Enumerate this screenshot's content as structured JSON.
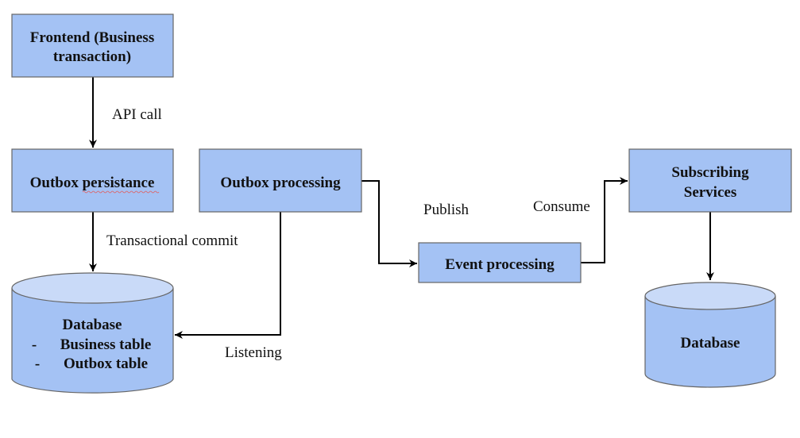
{
  "colors": {
    "box_fill": "#a4c2f4",
    "box_border": "#666666",
    "cylinder_top": "#c9daf8",
    "edge": "#000000"
  },
  "nodes": {
    "frontend": {
      "lines": [
        "Frontend (Business",
        "transaction)"
      ]
    },
    "outbox_persistance": {
      "lines": [
        "Outbox persistance"
      ]
    },
    "outbox_processing": {
      "lines": [
        "Outbox processing"
      ]
    },
    "event_processing": {
      "lines": [
        "Event processing"
      ]
    },
    "subscribing_services": {
      "lines": [
        "Subscribing",
        "Services"
      ]
    },
    "database_left": {
      "lines": [
        "Database",
        "Business table",
        "Outbox table"
      ],
      "bullets": [
        "-",
        "-"
      ]
    },
    "database_right": {
      "lines": [
        "Database"
      ]
    }
  },
  "edges": {
    "api_call": "API call",
    "transactional_commit": "Transactional commit",
    "listening": "Listening",
    "publish": "Publish",
    "consume": "Consume"
  }
}
